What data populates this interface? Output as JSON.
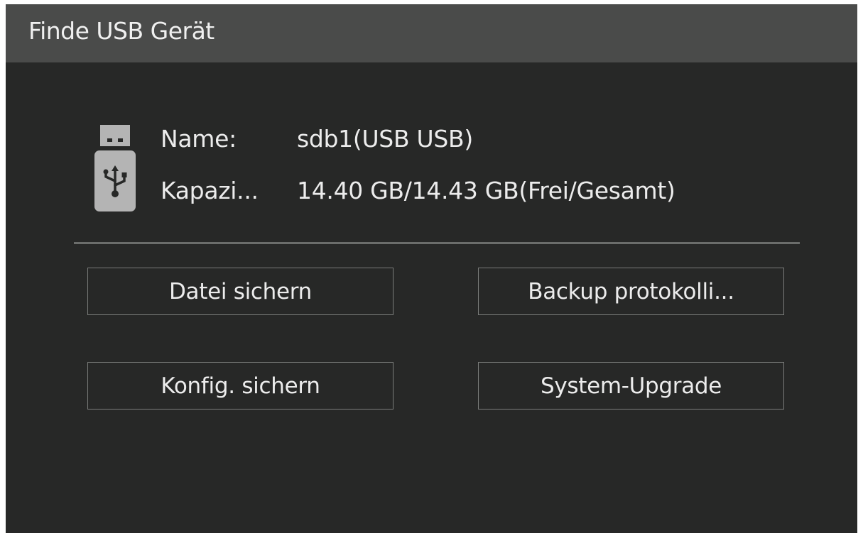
{
  "dialog": {
    "title": "Finde USB Gerät"
  },
  "device": {
    "icon": "usb-drive-icon",
    "name_label": "Name:",
    "name_value": "sdb1(USB USB)",
    "capacity_label": "Kapazi...",
    "capacity_value": "14.40 GB/14.43 GB(Frei/Gesamt)"
  },
  "buttons": {
    "file_backup": "Datei sichern",
    "backup_log": "Backup protokolli...",
    "config_backup": "Konfig. sichern",
    "system_upgrade": "System-Upgrade"
  },
  "colors": {
    "background": "#272827",
    "titlebar": "#4a4b4a",
    "text": "#ececec",
    "border": "#7a7c7a",
    "icon": "#b4b4b4"
  }
}
